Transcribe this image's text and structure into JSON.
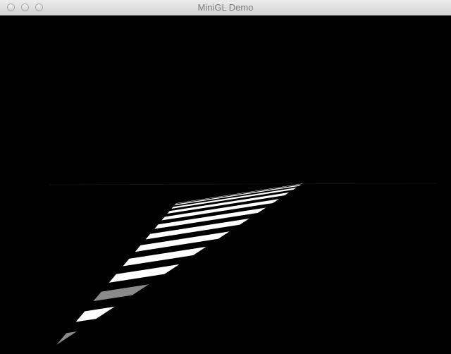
{
  "window": {
    "title": "MiniGL Demo"
  },
  "titlebar_buttons": [
    {
      "name": "close",
      "color": "#d8d8d8"
    },
    {
      "name": "minimize",
      "color": "#d8d8d8"
    },
    {
      "name": "zoom",
      "color": "#d8d8d8"
    }
  ],
  "scene": {
    "background_color": "#000000",
    "object": "perspective-checkered-triangle",
    "stripe_colors": [
      "#ffffff",
      "#000000",
      "#8a8a8a"
    ]
  }
}
